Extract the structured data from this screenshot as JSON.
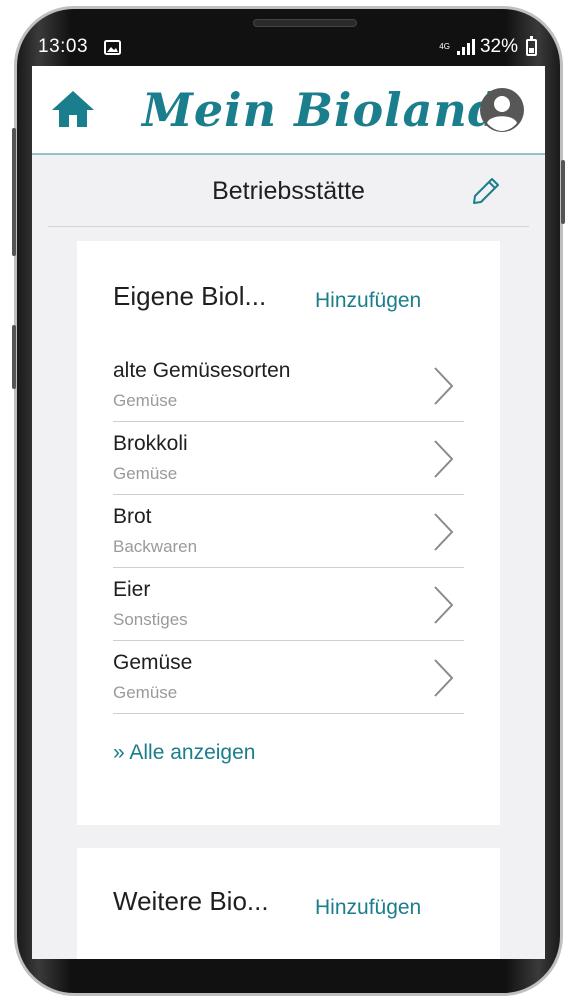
{
  "status_bar": {
    "time": "13:03",
    "network": "4G",
    "battery": "32%"
  },
  "header": {
    "logo_text": "Mein Bioland",
    "home_icon": "home-icon",
    "profile_icon": "account-circle-icon"
  },
  "section": {
    "title": "Betriebsstätte",
    "edit_icon": "pencil-icon"
  },
  "own_products": {
    "title": "Eigene Biol...",
    "add_label": "Hinzufügen",
    "items": [
      {
        "name": "alte Gemüsesorten",
        "category": "Gemüse"
      },
      {
        "name": "Brokkoli",
        "category": "Gemüse"
      },
      {
        "name": "Brot",
        "category": "Backwaren"
      },
      {
        "name": "Eier",
        "category": "Sonstiges"
      },
      {
        "name": "Gemüse",
        "category": "Gemüse"
      }
    ],
    "show_all_label": "» Alle anzeigen"
  },
  "more_products": {
    "title": "Weitere Bio...",
    "add_label": "Hinzufügen"
  },
  "colors": {
    "accent": "#1b7e8c",
    "background": "#f1f1f3",
    "header_divider": "#8fc4c9"
  }
}
